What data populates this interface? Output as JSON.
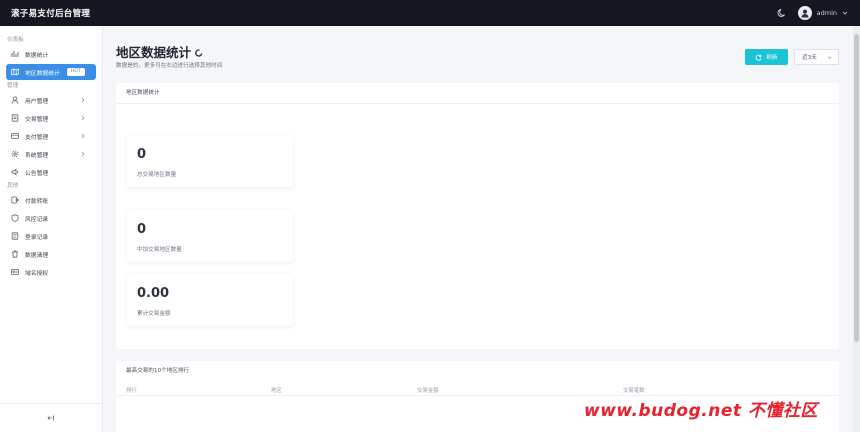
{
  "app": {
    "title": "滚子易支付后台管理"
  },
  "topbar": {
    "username": "admin"
  },
  "sidebar": {
    "groups": [
      {
        "label": "仪表板"
      },
      {
        "label": "管理"
      },
      {
        "label": "其他"
      }
    ],
    "items": [
      {
        "label": "数据统计",
        "icon": "bar-chart-icon"
      },
      {
        "label": "地区数据统计",
        "badge": "HOT",
        "icon": "map-icon",
        "active": true
      },
      {
        "label": "用户管理",
        "icon": "user-icon"
      },
      {
        "label": "交易管理",
        "icon": "document-icon"
      },
      {
        "label": "支付管理",
        "icon": "credit-card-icon"
      },
      {
        "label": "系统管理",
        "icon": "gear-icon"
      },
      {
        "label": "公告管理",
        "icon": "megaphone-icon"
      },
      {
        "label": "付款转账",
        "icon": "transfer-icon"
      },
      {
        "label": "风控记录",
        "icon": "shield-icon"
      },
      {
        "label": "登录记录",
        "icon": "log-icon"
      },
      {
        "label": "数据清理",
        "icon": "trash-icon"
      },
      {
        "label": "域名授权",
        "icon": "license-icon"
      }
    ]
  },
  "header": {
    "title": "地区数据统计",
    "subtitle": "数据是的，更多可在右边进行选择其他时间",
    "refresh_label": "刷新",
    "range_value": "近3天"
  },
  "main_card": {
    "title": "地区数据统计",
    "stats": [
      {
        "value": "0",
        "label": "总交易地区数量"
      },
      {
        "value": "0",
        "label": "中加交易地区数量"
      },
      {
        "value": "0.00",
        "label": "累计交易金额"
      }
    ]
  },
  "table": {
    "title": "最高交易的10个地区排行",
    "columns": [
      "排行",
      "地区",
      "交易金额",
      "交易笔数"
    ]
  },
  "watermark": "www.budog.net 不懂社区",
  "colors": {
    "accent": "#3a8ee6",
    "refresh": "#1cc2d6",
    "topbar": "#14171f"
  }
}
